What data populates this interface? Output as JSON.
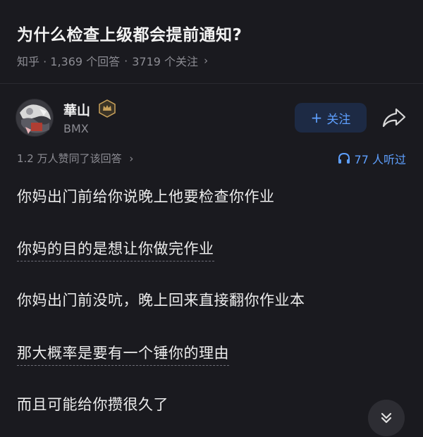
{
  "question": {
    "title": "为什么检查上级都会提前通知?",
    "answers": "知乎 · 1,369 个回答",
    "followers": "3719 个关注"
  },
  "author": {
    "name": "華山",
    "subtitle": "BMX",
    "follow_label": "关注"
  },
  "answer": {
    "likes": "1.2 万人赞同了该回答",
    "listeners": "77 人听过",
    "paragraphs": [
      "你妈出门前给你说晚上他要检查你作业",
      "你妈的目的是想让你做完作业",
      "你妈出门前没吭，晚上回来直接翻你作业本",
      "那大概率是要有一个锤你的理由",
      "而且可能给你攒很久了"
    ]
  },
  "colors": {
    "background": "#1a1a1f",
    "accent": "#5ea0ff",
    "badge": "#c9a15a"
  },
  "icons": {
    "badge": "crown-badge-icon",
    "share": "share-arrow-icon",
    "headphones": "headphones-icon",
    "scroll": "double-chevron-down-icon"
  }
}
